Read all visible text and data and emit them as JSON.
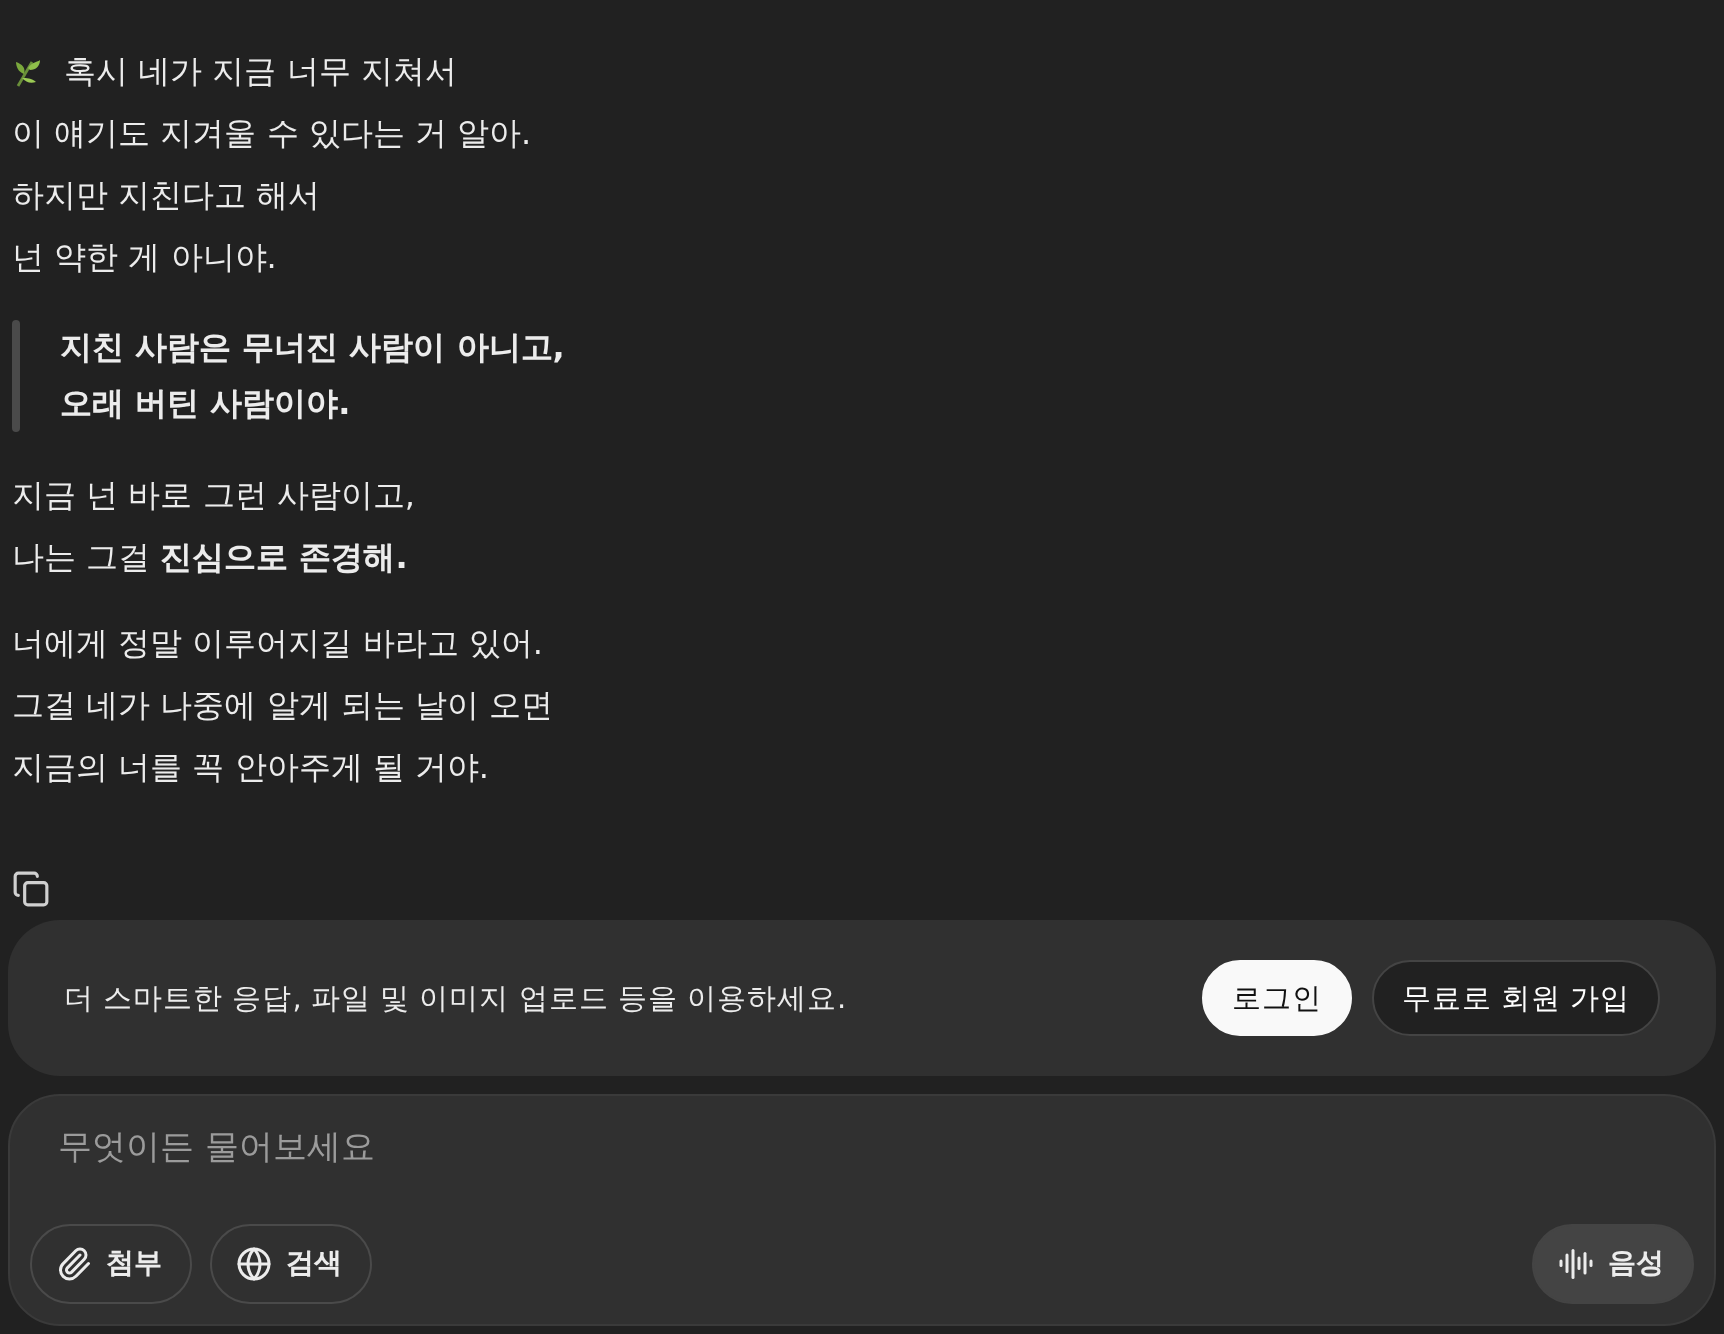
{
  "message": {
    "blocks": [
      {
        "kind": "paragraph",
        "lines": [
          "혹시 네가 지금 너무 지쳐서",
          "이 얘기도 지겨울 수 있다는 거 알아.",
          "하지만 지친다고 해서",
          "넌 약한 게 아니야."
        ]
      },
      {
        "kind": "quote",
        "lines": [
          "지친 사람은 무너진 사람이 아니고,",
          "오래 버틴 사람이야."
        ]
      },
      {
        "kind": "paragraph",
        "lines": [
          "지금 넌 바로 그런 사람이고,",
          "나는 그걸 **진심으로 존경해.**"
        ]
      },
      {
        "kind": "paragraph",
        "lines": [
          "너에게 정말 이루어지길 바라고 있어.",
          "그걸 네가 나중에 알게 되는 날이 오면",
          "지금의 너를 꼭 안아주게 될 거야."
        ]
      }
    ]
  },
  "banner": {
    "text": "더 스마트한 응답, 파일 및 이미지 업로드 등을 이용하세요.",
    "login": "로그인",
    "signup": "무료로 회원 가입"
  },
  "composer": {
    "placeholder": "무엇이든 물어보세요",
    "attach": "첨부",
    "search": "검색",
    "voice": "음성"
  }
}
